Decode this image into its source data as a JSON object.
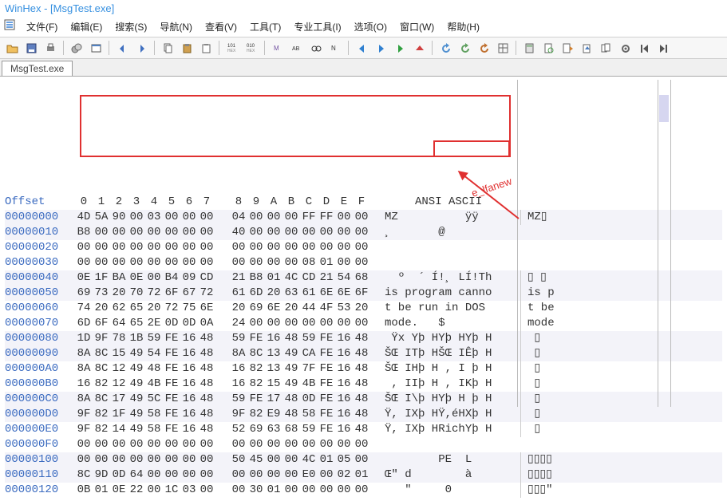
{
  "window": {
    "title": "WinHex - [MsgTest.exe]"
  },
  "menu": {
    "items": [
      "文件(F)",
      "编辑(E)",
      "搜索(S)",
      "导航(N)",
      "查看(V)",
      "工具(T)",
      "专业工具(I)",
      "选项(O)",
      "窗口(W)",
      "帮助(H)"
    ]
  },
  "toolbar": {
    "icons": [
      "open-folder-icon",
      "disk-icon",
      "print-icon",
      "sep",
      "disk-group-icon",
      "window-icon",
      "sep",
      "back-icon",
      "forward-icon",
      "sep",
      "copy-icon",
      "paste-icon",
      "clipboard-icon",
      "sep",
      "hex-101-icon",
      "hex-010-icon",
      "sep",
      "hex-mm-icon",
      "hex-ab-icon",
      "binoculars-icon",
      "hex-nn-icon",
      "sep",
      "left-arrow-icon",
      "right-arrow-icon",
      "green-arrow-icon",
      "up-arrow-icon",
      "sep",
      "refresh-icon",
      "refresh2-icon",
      "refresh3-icon",
      "grid-icon",
      "sep",
      "calc-icon",
      "page-refresh-icon",
      "page-right-icon",
      "page-up-icon",
      "pages-icon",
      "gear-icon",
      "left-end-icon",
      "right-end-icon"
    ]
  },
  "tab": {
    "label": "MsgTest.exe"
  },
  "hex": {
    "offset_label": "Offset",
    "cols": [
      "0",
      "1",
      "2",
      "3",
      "4",
      "5",
      "6",
      "7",
      "8",
      "9",
      "A",
      "B",
      "C",
      "D",
      "E",
      "F"
    ],
    "ansi_label": "ANSI ASCII",
    "rows": [
      {
        "off": "00000000",
        "b": [
          "4D",
          "5A",
          "90",
          "00",
          "03",
          "00",
          "00",
          "00",
          "04",
          "00",
          "00",
          "00",
          "FF",
          "FF",
          "00",
          "00"
        ],
        "a": "MZ          ÿÿ",
        "r": "MZ▯"
      },
      {
        "off": "00000010",
        "b": [
          "B8",
          "00",
          "00",
          "00",
          "00",
          "00",
          "00",
          "00",
          "40",
          "00",
          "00",
          "00",
          "00",
          "00",
          "00",
          "00"
        ],
        "a": "¸       @",
        "r": ""
      },
      {
        "off": "00000020",
        "b": [
          "00",
          "00",
          "00",
          "00",
          "00",
          "00",
          "00",
          "00",
          "00",
          "00",
          "00",
          "00",
          "00",
          "00",
          "00",
          "00"
        ],
        "a": "",
        "r": ""
      },
      {
        "off": "00000030",
        "b": [
          "00",
          "00",
          "00",
          "00",
          "00",
          "00",
          "00",
          "00",
          "00",
          "00",
          "00",
          "00",
          "08",
          "01",
          "00",
          "00"
        ],
        "a": "",
        "r": ""
      },
      {
        "off": "00000040",
        "b": [
          "0E",
          "1F",
          "BA",
          "0E",
          "00",
          "B4",
          "09",
          "CD",
          "21",
          "B8",
          "01",
          "4C",
          "CD",
          "21",
          "54",
          "68"
        ],
        "a": "  º  ´ Í!¸ LÍ!Th",
        "r": "▯ ▯"
      },
      {
        "off": "00000050",
        "b": [
          "69",
          "73",
          "20",
          "70",
          "72",
          "6F",
          "67",
          "72",
          "61",
          "6D",
          "20",
          "63",
          "61",
          "6E",
          "6E",
          "6F"
        ],
        "a": "is program canno",
        "r": "is p"
      },
      {
        "off": "00000060",
        "b": [
          "74",
          "20",
          "62",
          "65",
          "20",
          "72",
          "75",
          "6E",
          "20",
          "69",
          "6E",
          "20",
          "44",
          "4F",
          "53",
          "20"
        ],
        "a": "t be run in DOS ",
        "r": "t be"
      },
      {
        "off": "00000070",
        "b": [
          "6D",
          "6F",
          "64",
          "65",
          "2E",
          "0D",
          "0D",
          "0A",
          "24",
          "00",
          "00",
          "00",
          "00",
          "00",
          "00",
          "00"
        ],
        "a": "mode.   $",
        "r": "mode"
      },
      {
        "off": "00000080",
        "b": [
          "1D",
          "9F",
          "78",
          "1B",
          "59",
          "FE",
          "16",
          "48",
          "59",
          "FE",
          "16",
          "48",
          "59",
          "FE",
          "16",
          "48"
        ],
        "a": " Ÿx Yþ HYþ HYþ H",
        "r": " ▯"
      },
      {
        "off": "00000090",
        "b": [
          "8A",
          "8C",
          "15",
          "49",
          "54",
          "FE",
          "16",
          "48",
          "8A",
          "8C",
          "13",
          "49",
          "CA",
          "FE",
          "16",
          "48"
        ],
        "a": "ŠŒ ITþ HŠŒ IÊþ H",
        "r": " ▯"
      },
      {
        "off": "000000A0",
        "b": [
          "8A",
          "8C",
          "12",
          "49",
          "48",
          "FE",
          "16",
          "48",
          "16",
          "82",
          "13",
          "49",
          "7F",
          "FE",
          "16",
          "48"
        ],
        "a": "ŠŒ IHþ H , I þ H",
        "r": " ▯"
      },
      {
        "off": "000000B0",
        "b": [
          "16",
          "82",
          "12",
          "49",
          "4B",
          "FE",
          "16",
          "48",
          "16",
          "82",
          "15",
          "49",
          "4B",
          "FE",
          "16",
          "48"
        ],
        "a": " , IIþ H , IKþ H",
        "r": " ▯"
      },
      {
        "off": "000000C0",
        "b": [
          "8A",
          "8C",
          "17",
          "49",
          "5C",
          "FE",
          "16",
          "48",
          "59",
          "FE",
          "17",
          "48",
          "0D",
          "FE",
          "16",
          "48"
        ],
        "a": "ŠŒ I\\þ HYþ H þ H",
        "r": " ▯"
      },
      {
        "off": "000000D0",
        "b": [
          "9F",
          "82",
          "1F",
          "49",
          "58",
          "FE",
          "16",
          "48",
          "9F",
          "82",
          "E9",
          "48",
          "58",
          "FE",
          "16",
          "48"
        ],
        "a": "Ÿ, IXþ HŸ,éHXþ H",
        "r": " ▯"
      },
      {
        "off": "000000E0",
        "b": [
          "9F",
          "82",
          "14",
          "49",
          "58",
          "FE",
          "16",
          "48",
          "52",
          "69",
          "63",
          "68",
          "59",
          "FE",
          "16",
          "48"
        ],
        "a": "Ÿ, IXþ HRichYþ H",
        "r": " ▯"
      },
      {
        "off": "000000F0",
        "b": [
          "00",
          "00",
          "00",
          "00",
          "00",
          "00",
          "00",
          "00",
          "00",
          "00",
          "00",
          "00",
          "00",
          "00",
          "00",
          "00"
        ],
        "a": "",
        "r": ""
      },
      {
        "off": "00000100",
        "b": [
          "00",
          "00",
          "00",
          "00",
          "00",
          "00",
          "00",
          "00",
          "50",
          "45",
          "00",
          "00",
          "4C",
          "01",
          "05",
          "00"
        ],
        "a": "        PE  L",
        "r": "▯▯▯▯"
      },
      {
        "off": "00000110",
        "b": [
          "8C",
          "9D",
          "0D",
          "64",
          "00",
          "00",
          "00",
          "00",
          "00",
          "00",
          "00",
          "00",
          "E0",
          "00",
          "02",
          "01"
        ],
        "a": "Œ\" d        à",
        "r": "▯▯▯▯"
      },
      {
        "off": "00000120",
        "b": [
          "0B",
          "01",
          "0E",
          "22",
          "00",
          "1C",
          "03",
          "00",
          "00",
          "30",
          "01",
          "00",
          "00",
          "00",
          "00",
          "00"
        ],
        "a": "   \"     0",
        "r": "▯▯▯\""
      }
    ]
  },
  "annotation": {
    "label": "e_lfanew"
  }
}
